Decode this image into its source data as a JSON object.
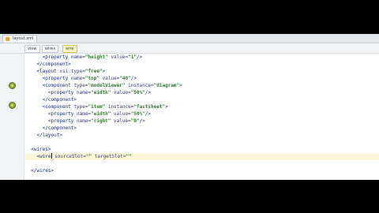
{
  "file_tab": {
    "label": "layout.xml"
  },
  "editor_tabs": [
    {
      "label": "view"
    },
    {
      "label": "wires"
    },
    {
      "label": "wire"
    }
  ],
  "code_lines": [
    {
      "indent": "      ",
      "tag": "<property",
      "attrs": [
        {
          "name": "name",
          "value": "\"height\""
        },
        {
          "name": "value",
          "value": "\"1\""
        }
      ],
      "close": "/>"
    },
    {
      "indent": "    ",
      "tag": "</component>",
      "attrs": [],
      "close": ""
    },
    {
      "indent": "    ",
      "tag": "<layout",
      "attrs": [
        {
          "name": "xsi:type",
          "value": "\"free\""
        }
      ],
      "close": ">"
    },
    {
      "indent": "      ",
      "tag": "<property",
      "attrs": [
        {
          "name": "name",
          "value": "\"top\""
        },
        {
          "name": "value",
          "value": "\"40\""
        }
      ],
      "close": "/>"
    },
    {
      "indent": "      ",
      "tag": "<component",
      "attrs": [
        {
          "name": "type",
          "value": "\"modelViewer\""
        },
        {
          "name": "instance",
          "value": "\"diagram\""
        }
      ],
      "close": ">"
    },
    {
      "indent": "        ",
      "tag": "<property",
      "attrs": [
        {
          "name": "name",
          "value": "\"width\""
        },
        {
          "name": "value",
          "value": "\"50%\""
        }
      ],
      "close": "/>"
    },
    {
      "indent": "      ",
      "tag": "</component>",
      "attrs": [],
      "close": ""
    },
    {
      "indent": "      ",
      "tag": "<component",
      "attrs": [
        {
          "name": "type",
          "value": "\"item\""
        },
        {
          "name": "instance",
          "value": "\"factsheet\""
        }
      ],
      "close": ">"
    },
    {
      "indent": "        ",
      "tag": "<property",
      "attrs": [
        {
          "name": "name",
          "value": "\"width\""
        },
        {
          "name": "value",
          "value": "\"50%\""
        }
      ],
      "close": "/>"
    },
    {
      "indent": "        ",
      "tag": "<property",
      "attrs": [
        {
          "name": "name",
          "value": "\"right\""
        },
        {
          "name": "value",
          "value": "\"0\""
        }
      ],
      "close": "/>"
    },
    {
      "indent": "      ",
      "tag": "</component>",
      "attrs": [],
      "close": ""
    },
    {
      "indent": "    ",
      "tag": "</layout>",
      "attrs": [],
      "close": ""
    },
    {
      "indent": "",
      "tag": "",
      "attrs": [],
      "close": ""
    },
    {
      "indent": "  ",
      "tag": "<wires>",
      "attrs": [],
      "close": ""
    },
    {
      "indent": "    ",
      "tag": "<wire",
      "attrs": [
        {
          "name": "sourceSlot",
          "value": "\"\""
        },
        {
          "name": "targetSlot",
          "value": "\"\""
        }
      ],
      "close": "",
      "current": true
    },
    {
      "indent": "",
      "tag": "",
      "attrs": [],
      "close": ""
    },
    {
      "indent": "  ",
      "tag": "</wires>",
      "attrs": [],
      "close": ""
    }
  ]
}
